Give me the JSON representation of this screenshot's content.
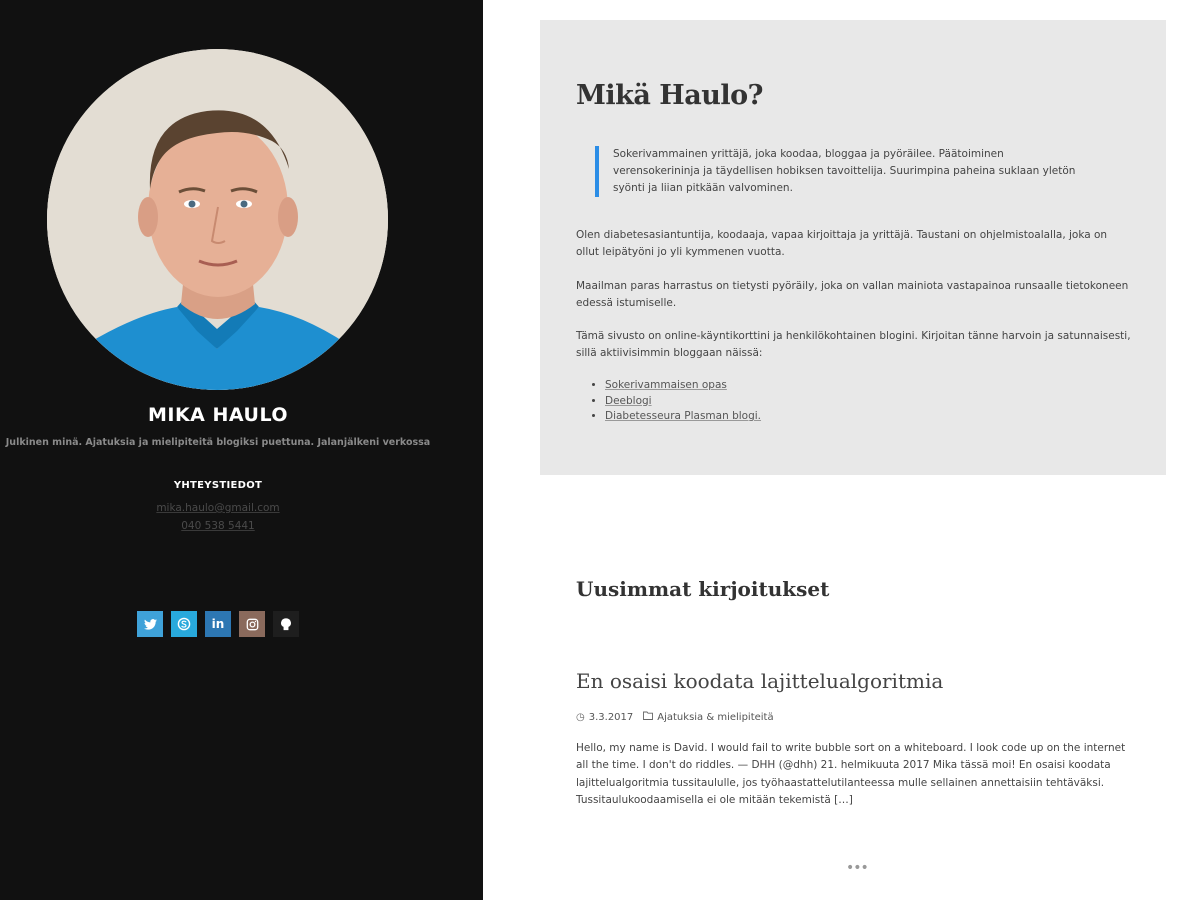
{
  "sidebar": {
    "site_title": "MIKA HAULO",
    "site_description": "Julkinen minä. Ajatuksia ja mielipiteitä blogiksi puettuna. Jalanjälkeni verkossa",
    "contact_heading": "YHTEYSTIEDOT",
    "email": "mika.haulo@gmail.com",
    "phone": "040 538 5441",
    "socials": [
      {
        "icon": "twitter-icon",
        "glyph": "🐦",
        "color": "#3fa2d9"
      },
      {
        "icon": "skype-icon",
        "glyph": "S",
        "color": "#28a9dc"
      },
      {
        "icon": "linkedin-icon",
        "glyph": "in",
        "color": "#2d77b3"
      },
      {
        "icon": "instagram-icon",
        "glyph": "◎",
        "color": "#8a6a5c"
      },
      {
        "icon": "github-icon",
        "glyph": "♟",
        "color": "#1e1e1e"
      }
    ]
  },
  "about": {
    "title": "Mikä Haulo?",
    "quote": "Sokerivammainen yrittäjä, joka koodaa, bloggaa ja pyöräilee. Päätoiminen verensokerininja ja täydellisen hobiksen tavoittelija. Suurimpina paheina suklaan yletön syönti ja liian pitkään valvominen.",
    "para1": "Olen diabetesasiantuntija, koodaaja, vapaa kirjoittaja ja yrittäjä. Taustani on ohjelmistoalalla, joka on ollut leipätyöni jo yli kymmenen vuotta.",
    "para2": "Maailman paras harrastus on tietysti pyöräily, joka on vallan mainiota vastapainoa runsaalle tietokoneen edessä istumiselle.",
    "para3": "Tämä sivusto on online-käyntikorttini ja henkilökohtainen blogini. Kirjoitan tänne harvoin ja satunnaisesti, sillä aktiivisimmin bloggaan näissä:",
    "links": [
      "Sokerivammaisen opas",
      "Deeblogi",
      "Diabetesseura Plasman blogi."
    ]
  },
  "latest": {
    "heading": "Uusimmat kirjoitukset",
    "post": {
      "title": "En osaisi koodata lajittelualgoritmia",
      "date": "3.3.2017",
      "category": "Ajatuksia & mielipiteitä",
      "excerpt": "Hello, my name is David. I would fail to write bubble sort on a whiteboard. I look code up on the internet all the time. I don't do riddles. — DHH (@dhh) 21. helmikuuta 2017   Mika tässä moi! En osaisi koodata lajittelualgoritmia tussitaululle, jos työhaastattelutilanteessa mulle sellainen annettaisiin tehtäväksi. Tussitaulukoodaamisella ei ole mitään tekemistä […]"
    },
    "more": "•••"
  }
}
